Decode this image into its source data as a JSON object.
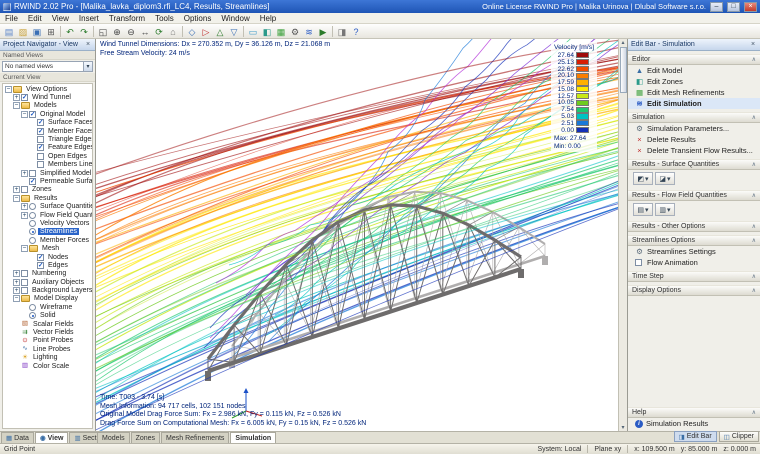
{
  "title_bar": {
    "title": "RWIND 2.02 Pro - [Malika_lavka_diplom3.rfi_LC4, Results, Streamlines]",
    "license_text": "Online License RWIND Pro | Malika Urinova | Dlubal Software s.r.o.",
    "window_buttons": {
      "minimize": "–",
      "maximize": "□",
      "close": "×"
    }
  },
  "menu_bar": {
    "items": [
      "File",
      "Edit",
      "View",
      "Insert",
      "Transform",
      "Tools",
      "Options",
      "Window",
      "Help"
    ]
  },
  "toolbar": {
    "icons": [
      {
        "name": "new-file",
        "glyph": "▤",
        "color": "#5b85c9"
      },
      {
        "name": "open-file",
        "glyph": "▨",
        "color": "#c9a23a"
      },
      {
        "name": "save-file",
        "glyph": "▣",
        "color": "#3a6fb5"
      },
      {
        "name": "print",
        "glyph": "⊞",
        "color": "#555555"
      },
      {
        "sep": true
      },
      {
        "name": "undo",
        "glyph": "↶",
        "color": "#2a7a2a"
      },
      {
        "name": "redo",
        "glyph": "↷",
        "color": "#2a7a2a"
      },
      {
        "sep": true
      },
      {
        "name": "zoom-window",
        "glyph": "◱",
        "color": "#444444"
      },
      {
        "name": "zoom-in",
        "glyph": "⊕",
        "color": "#444444"
      },
      {
        "name": "zoom-out",
        "glyph": "⊖",
        "color": "#444444"
      },
      {
        "name": "pan",
        "glyph": "↔",
        "color": "#444444"
      },
      {
        "name": "rotate-view",
        "glyph": "⟳",
        "color": "#2a7a2a"
      },
      {
        "name": "home-view",
        "glyph": "⌂",
        "color": "#777777"
      },
      {
        "sep": true
      },
      {
        "name": "isometric-view",
        "glyph": "◇",
        "color": "#3a6fb5"
      },
      {
        "name": "view-in-x",
        "glyph": "▷",
        "color": "#c03030"
      },
      {
        "name": "view-in-y",
        "glyph": "△",
        "color": "#2a7a2a"
      },
      {
        "name": "view-in-z",
        "glyph": "▽",
        "color": "#3a6fb5"
      },
      {
        "sep": true
      },
      {
        "name": "wind-tunnel",
        "glyph": "▭",
        "color": "#3a9ac9"
      },
      {
        "name": "zones",
        "glyph": "◧",
        "color": "#2a9a8a"
      },
      {
        "name": "mesh-refinements",
        "glyph": "▦",
        "color": "#3aa03a"
      },
      {
        "name": "simulation-parameters",
        "glyph": "⚙",
        "color": "#555555"
      },
      {
        "name": "streamlines",
        "glyph": "≋",
        "color": "#2a5bc4"
      },
      {
        "name": "flow-animation",
        "glyph": "▶",
        "color": "#2a7a2a"
      },
      {
        "sep": true
      },
      {
        "name": "display-properties",
        "glyph": "◨",
        "color": "#777777"
      },
      {
        "name": "help",
        "glyph": "?",
        "color": "#2a5bc4"
      }
    ]
  },
  "navigator": {
    "title": "Project Navigator - View",
    "named_views_label": "Named Views",
    "named_views_value": "No named views",
    "current_view_label": "Current View",
    "tree": [
      {
        "label": "View Options",
        "level": 0,
        "icon": "folder",
        "expand": "minus",
        "ctrl": "none"
      },
      {
        "label": "Wind Tunnel",
        "level": 1,
        "expand": "plus",
        "ctrl": "check",
        "checked": true
      },
      {
        "label": "Models",
        "level": 1,
        "icon": "folder",
        "expand": "minus",
        "ctrl": "none"
      },
      {
        "label": "Original Model",
        "level": 2,
        "expand": "minus",
        "ctrl": "check",
        "checked": true
      },
      {
        "label": "Surface Faces",
        "level": 3,
        "ctrl": "check",
        "checked": true
      },
      {
        "label": "Member Faces",
        "level": 3,
        "ctrl": "check",
        "checked": true
      },
      {
        "label": "Triangle Edges",
        "level": 3,
        "ctrl": "check",
        "checked": false
      },
      {
        "label": "Feature Edges",
        "level": 3,
        "ctrl": "check",
        "checked": true
      },
      {
        "label": "Open Edges",
        "level": 3,
        "ctrl": "check",
        "checked": false
      },
      {
        "label": "Members Lines",
        "level": 3,
        "ctrl": "check",
        "checked": false
      },
      {
        "label": "Simplified Model",
        "level": 2,
        "expand": "plus",
        "ctrl": "check",
        "checked": false
      },
      {
        "label": "Permeable Surfaces",
        "level": 2,
        "ctrl": "check",
        "checked": true
      },
      {
        "label": "Zones",
        "level": 1,
        "expand": "plus",
        "ctrl": "check",
        "checked": false
      },
      {
        "label": "Results",
        "level": 1,
        "icon": "folder",
        "expand": "minus",
        "ctrl": "none"
      },
      {
        "label": "Surface Quantities",
        "level": 2,
        "expand": "plus",
        "ctrl": "radio",
        "checked": false
      },
      {
        "label": "Flow Field Quantities",
        "level": 2,
        "expand": "plus",
        "ctrl": "radio",
        "checked": false
      },
      {
        "label": "Velocity Vectors",
        "level": 2,
        "ctrl": "radio",
        "checked": false
      },
      {
        "label": "Streamlines",
        "level": 2,
        "ctrl": "radio",
        "checked": true,
        "selected": true
      },
      {
        "label": "Member Forces",
        "level": 2,
        "ctrl": "radio",
        "checked": false
      },
      {
        "label": "Mesh",
        "level": 2,
        "icon": "folder",
        "expand": "minus",
        "ctrl": "none"
      },
      {
        "label": "Nodes",
        "level": 3,
        "ctrl": "check",
        "checked": true
      },
      {
        "label": "Edges",
        "level": 3,
        "ctrl": "check",
        "checked": true
      },
      {
        "label": "Numbering",
        "level": 1,
        "expand": "plus",
        "ctrl": "check",
        "checked": false
      },
      {
        "label": "Auxiliary Objects",
        "level": 1,
        "expand": "plus",
        "ctrl": "check",
        "checked": false
      },
      {
        "label": "Background Layers",
        "level": 1,
        "expand": "plus",
        "ctrl": "check",
        "checked": false
      },
      {
        "label": "Model Display",
        "level": 1,
        "icon": "folder",
        "expand": "minus",
        "ctrl": "none"
      },
      {
        "label": "Wireframe",
        "level": 2,
        "ctrl": "radio",
        "checked": false
      },
      {
        "label": "Solid",
        "level": 2,
        "ctrl": "radio",
        "checked": true
      },
      {
        "label": "Scalar Fields",
        "level": 1,
        "ctrl": "none",
        "glyph": "▧",
        "color": "#b06030"
      },
      {
        "label": "Vector Fields",
        "level": 1,
        "ctrl": "none",
        "glyph": "⇉",
        "color": "#2a7a2a"
      },
      {
        "label": "Point Probes",
        "level": 1,
        "ctrl": "none",
        "glyph": "⊙",
        "color": "#c03030"
      },
      {
        "label": "Line Probes",
        "level": 1,
        "ctrl": "none",
        "glyph": "∿",
        "color": "#3a6ea5"
      },
      {
        "label": "Lighting",
        "level": 1,
        "ctrl": "none",
        "glyph": "☀",
        "color": "#d8a020"
      },
      {
        "label": "Color Scale",
        "level": 1,
        "ctrl": "none",
        "glyph": "▥",
        "color": "#7a30c0"
      }
    ]
  },
  "viewport": {
    "info_line1": "Wind Tunnel Dimensions: Dx = 270.352 m, Dy = 36.126 m, Dz = 21.068 m",
    "info_line2": "Free Stream Velocity: 24 m/s",
    "legend": {
      "title": "Velocity [m/s]",
      "values": [
        "27.64",
        "25.13",
        "22.62",
        "20.10",
        "17.59",
        "15.08",
        "12.57",
        "10.05",
        "7.54",
        "5.03",
        "2.51",
        "0.00"
      ],
      "colors": [
        "#9e0b0b",
        "#d81e05",
        "#f44d00",
        "#fb7d00",
        "#ffb000",
        "#ffe800",
        "#c8e816",
        "#6ecb1e",
        "#1fc86e",
        "#00c2c2",
        "#1a78d8",
        "#1430b8"
      ],
      "max_label": "Max: 27.64",
      "min_label": "Min: 0.00"
    },
    "status_lines": [
      "Time: T003 - 3.74 [s]",
      "Mesh Information: 94 717 cells, 102 151 nodes",
      "Original Model Drag Force Sum: Fx = 2.986 kN, Fy = 0.115 kN, Fz = 0.526 kN",
      "Drag Force Sum on Computational Mesh: Fx = 6.005 kN, Fy = 0.15 kN, Fz = 0.526 kN"
    ]
  },
  "edit_bar": {
    "title": "Edit Bar - Simulation",
    "groups": [
      {
        "header": "Editor",
        "items": [
          {
            "label": "Edit Model",
            "icon": "edit-model",
            "glyph": "▲",
            "color": "#3a6ea5"
          },
          {
            "label": "Edit Zones",
            "icon": "edit-zones",
            "glyph": "◧",
            "color": "#2a9a8a"
          },
          {
            "label": "Edit Mesh Refinements",
            "icon": "edit-mesh-refinements",
            "glyph": "▦",
            "color": "#3aa03a"
          },
          {
            "label": "Edit Simulation",
            "icon": "edit-simulation",
            "glyph": "≋",
            "color": "#2a5bc4",
            "active": true
          }
        ]
      },
      {
        "header": "Simulation",
        "items": [
          {
            "label": "Simulation Parameters...",
            "icon": "simulation-parameters",
            "glyph": "⚙",
            "color": "#5a6a7a"
          },
          {
            "label": "Delete Results",
            "icon": "delete-results",
            "glyph": "×",
            "color": "#c03030"
          },
          {
            "label": "Delete Transient Flow Results...",
            "icon": "delete-transient-flow-results",
            "glyph": "×",
            "color": "#c03030"
          }
        ]
      },
      {
        "header": "Results - Surface Quantities",
        "buttons": [
          {
            "name": "surface-pressure-quantity",
            "glyph": "◩"
          },
          {
            "name": "surface-velocity-quantity",
            "glyph": "◪"
          }
        ]
      },
      {
        "header": "Results - Flow Field Quantities",
        "buttons": [
          {
            "name": "flow-field-slicer",
            "glyph": "▤"
          },
          {
            "name": "flow-field-vectors",
            "glyph": "▥"
          }
        ]
      },
      {
        "header": "Results - Other Options"
      },
      {
        "header": "Streamlines Options",
        "items": [
          {
            "label": "Streamlines Settings",
            "icon": "streamlines-settings",
            "glyph": "⚙",
            "color": "#5a6a7a"
          },
          {
            "label": "Flow Animation",
            "checkbox": true,
            "checked": false
          }
        ]
      },
      {
        "header": "Time Step"
      },
      {
        "header": "Display Options"
      },
      {
        "header": "Help",
        "bottom": true,
        "items": [
          {
            "label": "Simulation Results",
            "icon": "info"
          }
        ]
      }
    ]
  },
  "bottom_tabs": {
    "navigator_tabs": [
      {
        "label": "Data",
        "glyph": "▦"
      },
      {
        "label": "View",
        "glyph": "◉",
        "active": true
      },
      {
        "label": "Sections",
        "glyph": "▥"
      }
    ],
    "main_tabs": [
      {
        "label": "Models"
      },
      {
        "label": "Zones"
      },
      {
        "label": "Mesh Refinements"
      },
      {
        "label": "Simulation",
        "active": true
      }
    ],
    "panel_buttons": [
      {
        "label": "Edit Bar",
        "glyph": "◨",
        "active": true
      },
      {
        "label": "Clipper",
        "glyph": "◫"
      }
    ]
  },
  "status_bar": {
    "snap": "Grid Point",
    "system": "System: Local",
    "plane": "Plane xy",
    "x": "x: 109.500 m",
    "y": "y: 85.000 m",
    "z": "z: 0.000 m"
  }
}
